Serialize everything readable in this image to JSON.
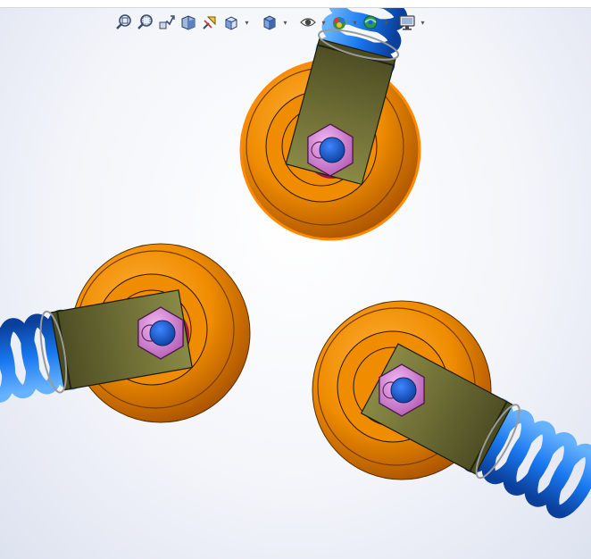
{
  "toolbar": {
    "tools": [
      {
        "id": "zoom-to-fit-icon"
      },
      {
        "id": "zoom-to-area-icon"
      },
      {
        "id": "previous-view-icon"
      },
      {
        "id": "section-view-icon"
      },
      {
        "id": "dynamic-annotation-view-icon"
      },
      {
        "id": "view-orientation-icon",
        "has_dropdown": true
      },
      {
        "id": "display-style-icon",
        "has_dropdown": true
      },
      {
        "id": "hide-show-items-icon",
        "has_dropdown": true
      },
      {
        "id": "edit-appearance-icon",
        "has_dropdown": true
      },
      {
        "id": "apply-scene-icon",
        "has_dropdown": true
      },
      {
        "id": "view-settings-icon",
        "has_dropdown": true
      }
    ]
  },
  "model": {
    "wheel_color": "#ef8c00",
    "wheel_dark": "#b35d00",
    "hub_color": "#c8175f",
    "fork_color": "#6b6b33",
    "nut_color": "#d98ad9",
    "axle_color": "#1a5fd6",
    "spring_color": "#1877f0",
    "selection_color": "#ff8a00",
    "selected_wheel": "top"
  }
}
